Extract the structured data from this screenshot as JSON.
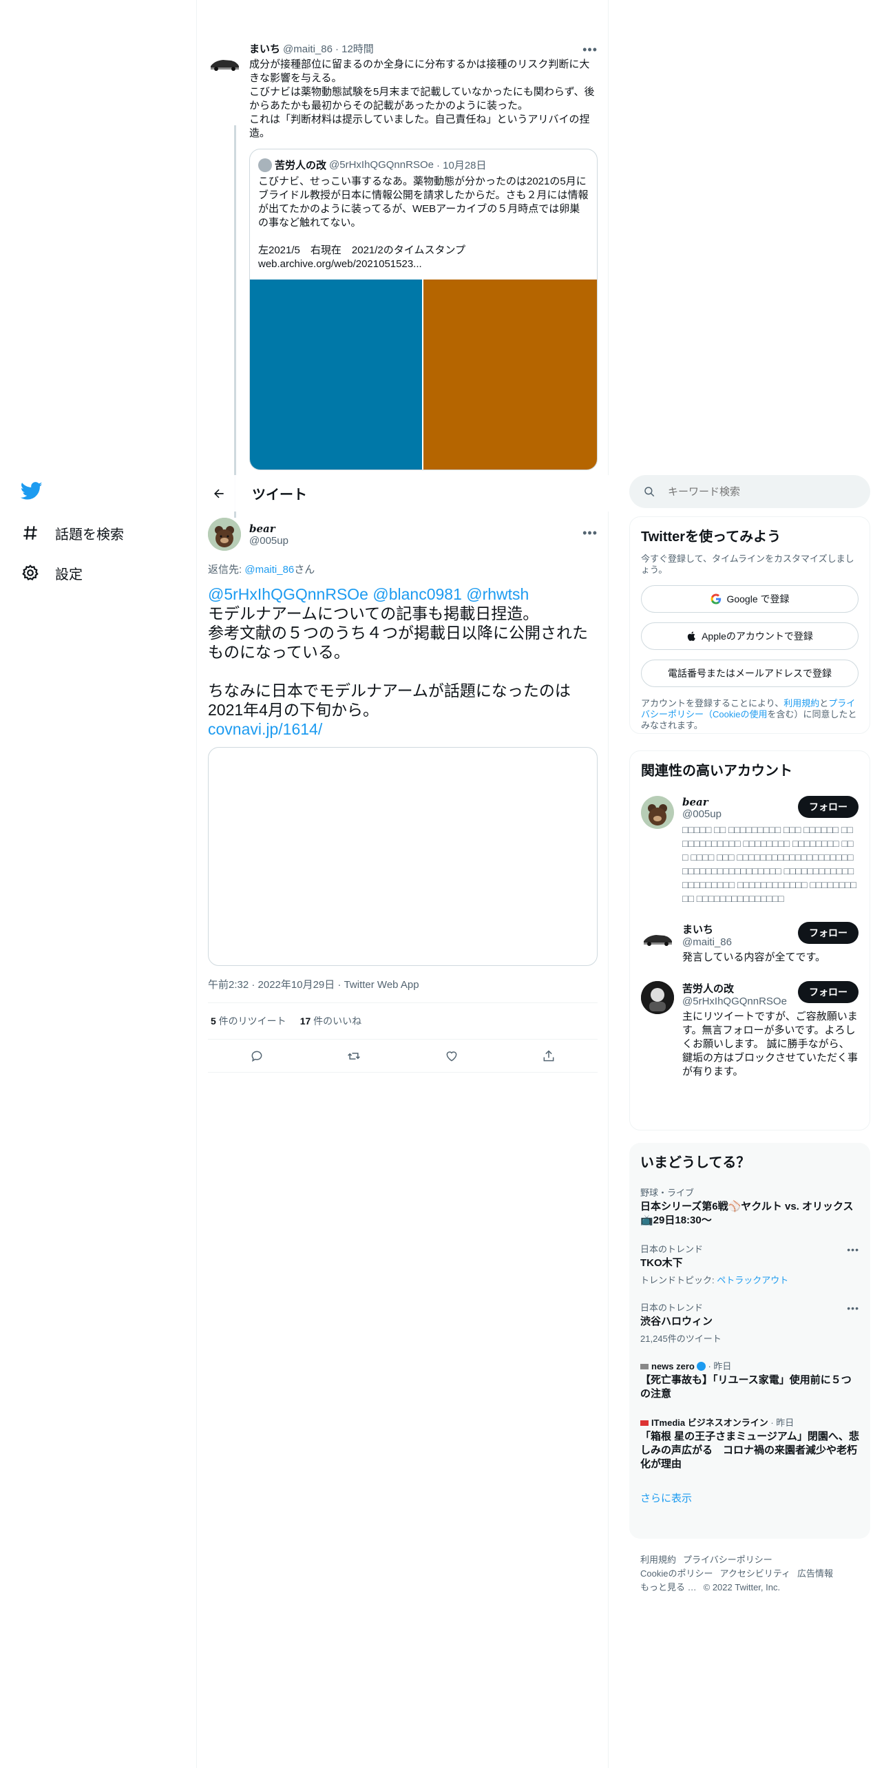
{
  "nav": {
    "items": [
      {
        "label": "話題を検索"
      },
      {
        "label": "設定"
      }
    ]
  },
  "parent_tweet": {
    "name": "まいち",
    "handle": "@maiti_86",
    "time": "· 12時間",
    "text": "成分が接種部位に留まるのか全身にに分布するかは接種のリスク判断に大きな影響を与える。\nこびナビは薬物動態試験を5月末まで記載していなかったにも関わらず、後からあたかも最初からその記載があったかのように装った。\nこれは「判断材料は提示していました。自己責任ね」というアリバイの捏造。",
    "quote": {
      "name": "苦労人の改",
      "handle": "@5rHxIhQGQnnRSOe",
      "time": "· 10月28日",
      "text": "こびナビ、せっこい事するなあ。薬物動態が分かったのは2021の5月にブライドル教授が日本に情報公開を請求したからだ。さも２月には情報が出てたかのように装ってるが、WEBアーカイブの５月時点では卵巣の事など触れてない。\n\n左2021/5　右現在　2021/2のタイムスタンプ\nweb.archive.org/web/2021051523..."
    }
  },
  "header": {
    "title": "ツイート"
  },
  "main_tweet": {
    "name": "bear",
    "handle": "@005up",
    "reply_prefix": "返信先: ",
    "reply_to": "@maiti_86",
    "reply_suffix": "さん",
    "mentions": "@5rHxIhQGQnnRSOe @blanc0981 @rhwtsh",
    "text": "モデルナアームについての記事も掲載日捏造。\n参考文献の５つのうち４つが掲載日以降に公開されたものになっている。\n\nちなみに日本でモデルナアームが話題になったのは2021年4月の下旬から。",
    "link": "covnavi.jp/1614/",
    "meta": "午前2:32 · 2022年10月29日 · Twitter Web App",
    "retweets": "5",
    "retweets_label": " 件のリツイート",
    "likes": "17",
    "likes_label": " 件のいいね"
  },
  "search": {
    "placeholder": "キーワード検索"
  },
  "signup": {
    "title": "Twitterを使ってみよう",
    "subtitle": "今すぐ登録して、タイムラインをカスタマイズしましょう。",
    "google": "Google で登録",
    "apple": "Appleのアカウントで登録",
    "phone": "電話番号またはメールアドレスで登録",
    "terms_prefix": "アカウントを登録することにより、",
    "terms_link1": "利用規約",
    "terms_and": "と",
    "terms_link2": "プライバシーポリシー",
    "terms_link3": "（Cookieの使用",
    "terms_suffix": "を含む）に同意したとみなされます。"
  },
  "related": {
    "title": "関連性の高いアカウント",
    "follow_label": "フォロー",
    "accounts": [
      {
        "name": "bear",
        "handle": "@005up",
        "bio": "□□□□□ □□ □□□□□□□□□ □□□ □□□□□□ □□□□□□□□□□□□ □□□□□□□□ □□□□□□□□ □□□ □□□□ □□□ □□□□□□□□□□□□□□□□□□□□□□□□□□□□□□□□□□□□□ □□□□□□□□□□□□□□□□□□□□□ □□□□□□□□□□□□ □□□□□□□□□□ □□□□□□□□□□□□□□□"
      },
      {
        "name": "まいち",
        "handle": "@maiti_86",
        "bio": "発言している内容が全てです。"
      },
      {
        "name": "苦労人の改",
        "handle": "@5rHxIhQGQnnRSOe",
        "bio": "主にリツイートですが、ご容赦願います。無言フォローが多いです。よろしくお願いします。 誠に勝手ながら、鍵垢の方はブロックさせていただく事が有ります。"
      }
    ]
  },
  "trends": {
    "title": "いまどうしてる？",
    "items": [
      {
        "context": "野球・ライブ",
        "title": "日本シリーズ第6戦⚾ヤクルト vs. オリックス📺29日18:30〜",
        "sub": ""
      },
      {
        "context": "日本のトレンド",
        "title": "TKO木下",
        "sub_prefix": "トレンドトピック: ",
        "sub_link": "ペトラックアウト"
      },
      {
        "context": "日本のトレンド",
        "title": "渋谷ハロウィン",
        "sub": "21,245件のツイート"
      },
      {
        "context": "news zero",
        "context_suffix": " · 昨日",
        "title": "【死亡事故も】「リユース家電」使用前に５つの注意"
      },
      {
        "context": "ITmedia ビジネスオンライン",
        "context_suffix": " · 昨日",
        "title": "「箱根 星の王子さまミュージアム」閉園へ、悲しみの声広がる　コロナ禍の来園者減少や老朽化が理由"
      }
    ],
    "show_more": "さらに表示"
  },
  "footer": {
    "links": [
      "利用規約",
      "プライバシーポリシー",
      "Cookieのポリシー",
      "アクセシビリティ",
      "広告情報",
      "もっと見る …"
    ],
    "copyright": "© 2022 Twitter, Inc."
  }
}
